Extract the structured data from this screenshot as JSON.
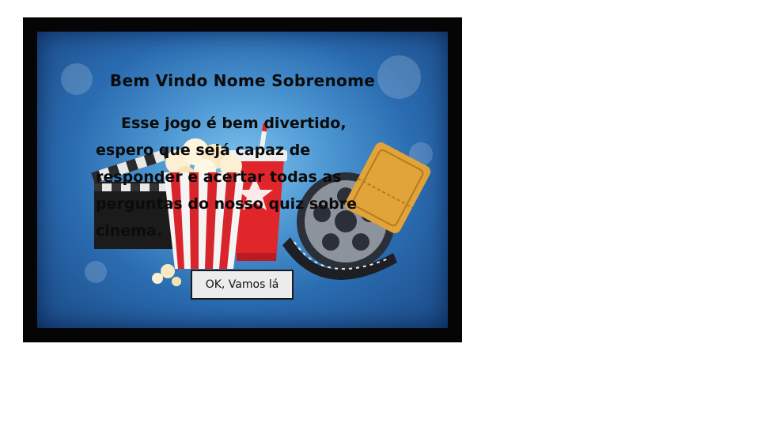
{
  "dialog": {
    "title": "Bem Vindo Nome Sobrenome",
    "message": "Esse jogo é bem divertido, espero que sejá capaz de responder e acertar todas as perguntas do nosso quiz sobre cinema.",
    "ok_button_label": "OK, Vamos lá"
  },
  "background": {
    "theme": "cinema illustration",
    "elements": [
      "clapperboard-icon",
      "popcorn-icon",
      "soda-cup-icon",
      "film-reel-icon",
      "cinema-ticket-icon"
    ]
  },
  "colors": {
    "frame": "#050505",
    "panel_light": "#7fc3ee",
    "panel_dark": "#1b4a85",
    "popcorn_red": "#d8242b",
    "cup_red": "#e0252b",
    "ticket_gold": "#d9a032",
    "button_bg": "#ececec"
  }
}
